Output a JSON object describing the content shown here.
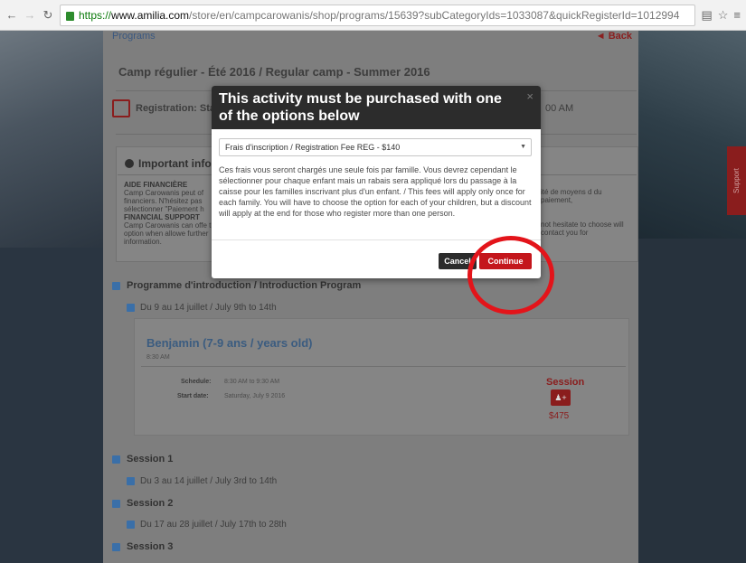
{
  "browser": {
    "url_scheme": "https://",
    "url_host": "www.amilia.com",
    "url_path": "/store/en/campcarowanis/shop/programs/15639?subCategoryIds=1033087&quickRegisterId=1012994"
  },
  "page": {
    "programs_link": "Programs",
    "back_link": "Back",
    "camp_title": "Camp régulier - Été 2016 / Regular camp - Summer 2016",
    "registration_label": "Registration: Start",
    "registration_time": "00 AM",
    "info_title": "Important info",
    "info_left_heading": "AIDE FINANCIÈRE",
    "info_left_text": "Camp Carowanis peut of financiers. N'hésitez pas sélectionner \"Paiement h",
    "info_left_heading2": "FINANCIAL SUPPORT",
    "info_left_text2": "Camp Carowanis can offe that option when allowe further information.",
    "info_right_text": "ité de moyens d du paiement,",
    "info_right_text2": "not hesitate to choose will contact you for",
    "sections": [
      {
        "label": "Programme d'introduction / Introduction Program"
      },
      {
        "label": "Session 1"
      },
      {
        "label": "Session 2"
      },
      {
        "label": "Session 3"
      }
    ],
    "subs": [
      {
        "label": "Du 9 au 14 juillet / July 9th to 14th"
      },
      {
        "label": "Du 3 au 14 juillet / July 3rd to 14th"
      },
      {
        "label": "Du 17 au 28 juillet / July 17th to 28th"
      }
    ],
    "activity": {
      "title": "Benjamin (7-9 ans / years old)",
      "time": "8:30 AM",
      "schedule_label": "Schedule:",
      "schedule_value": "8:30 AM to 9:30 AM",
      "start_label": "Start date:",
      "start_value": "Saturday, July 9 2016",
      "session_label": "Session",
      "price": "$475"
    },
    "support_tab": "Support"
  },
  "modal": {
    "title": "This activity must be purchased with one of the options below",
    "close": "×",
    "select_value": "Frais d'inscription / Registration Fee REG - $140",
    "body": "Ces frais vous seront chargés une seule fois par famille. Vous devrez cependant le sélectionner pour chaque enfant mais un rabais sera appliqué lors du passage à la caisse pour les familles inscrivant plus d'un enfant. / This fees will apply only once for each family. You will have to choose the option for each of your children, but a discount will apply at the end for those who register more than one person.",
    "cancel_label": "Cancel",
    "continue_label": "Continue"
  },
  "colors": {
    "accent_red": "#c4161c",
    "annotation_red": "#e3141a",
    "modal_header": "#2c2c2c"
  }
}
